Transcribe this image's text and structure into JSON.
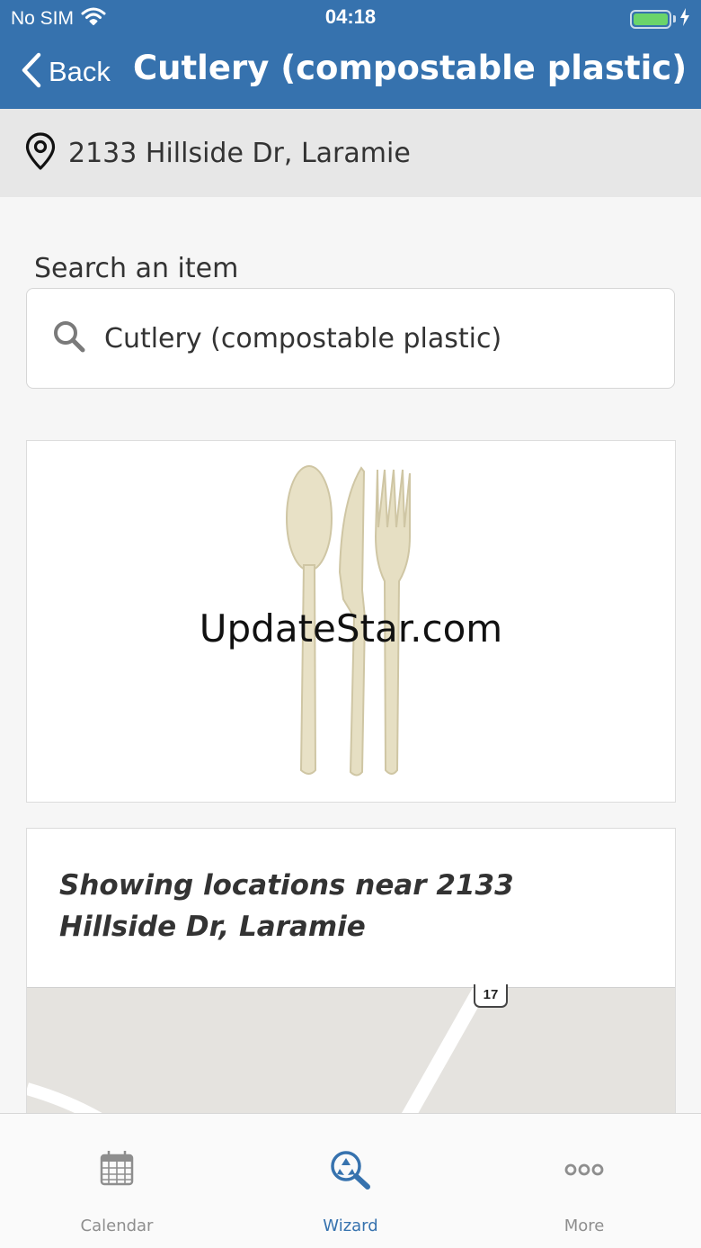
{
  "status_bar": {
    "carrier": "No SIM",
    "time": "04:18",
    "battery_level": 1.0
  },
  "nav": {
    "back_label": "Back",
    "title": "Cutlery (compostable plastic)"
  },
  "location": {
    "address": "2133 Hillside Dr, Laramie",
    "icon": "map-pin-icon"
  },
  "search": {
    "label": "Search an item",
    "value": "Cutlery (compostable plastic)",
    "icon": "search-icon"
  },
  "item_image": {
    "watermark": "UpdateStar.com"
  },
  "locations": {
    "heading": "Showing locations near 2133 Hillside Dr, Laramie",
    "map_route_label": "17"
  },
  "tabs": [
    {
      "label": "Calendar",
      "icon": "calendar-icon",
      "active": false
    },
    {
      "label": "Wizard",
      "icon": "recycle-search-icon",
      "active": true
    },
    {
      "label": "More",
      "icon": "more-dots-icon",
      "active": false
    }
  ],
  "colors": {
    "header": "#3672ae",
    "accent": "#3672ae",
    "battery": "#6ad46a"
  }
}
